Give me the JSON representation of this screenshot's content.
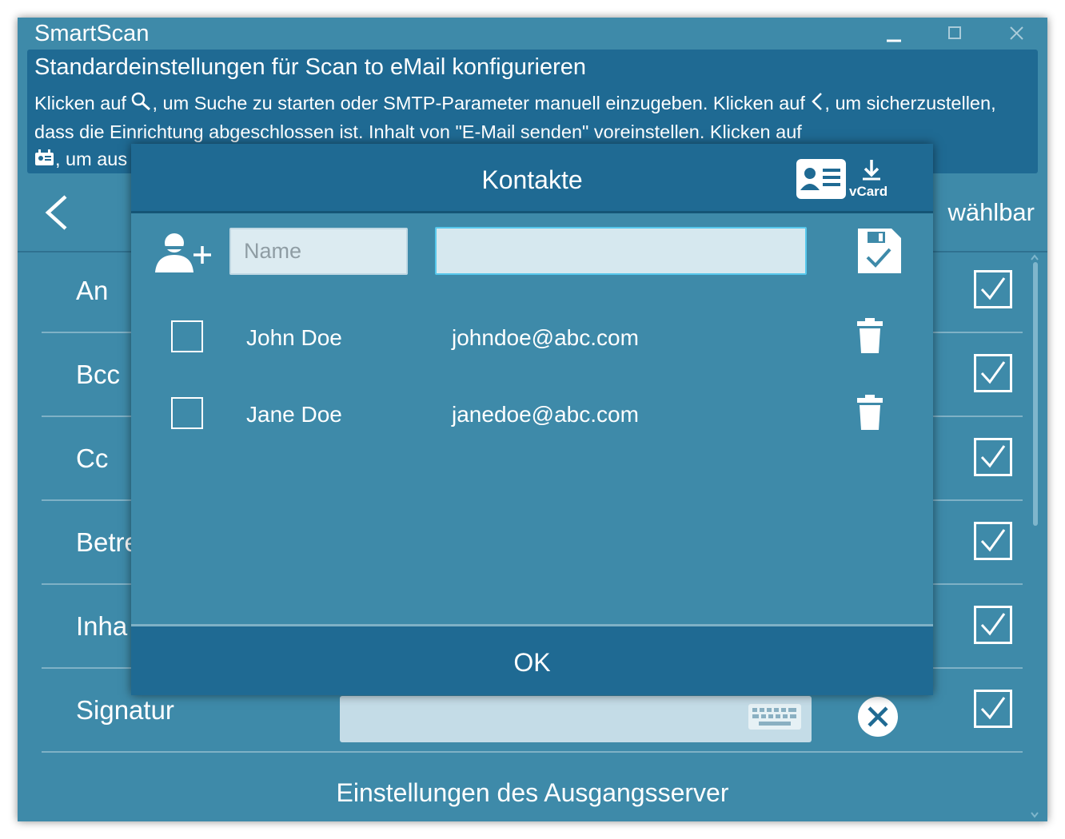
{
  "window": {
    "title": "SmartScan",
    "controls": [
      "minimize-icon",
      "maximize-icon",
      "close-icon"
    ]
  },
  "header": {
    "title": "Standardeinstellungen für Scan to eMail konfigurieren",
    "desc_part1": "Klicken auf ",
    "desc_part2": ", um Suche zu starten oder SMTP-Parameter manuell einzugeben. Klicken auf ",
    "desc_part3": ", um sicherzustellen, dass die Einrichtung abgeschlossen ist. Inhalt von \"E-Mail senden\" voreinstellen. Klicken auf ",
    "desc_part4": ", um aus",
    "icons": [
      "search-icon",
      "chevron-left-icon",
      "contacts-card-icon"
    ]
  },
  "settings": {
    "column_header": "wählbar",
    "rows": [
      {
        "label": "An",
        "checked": true
      },
      {
        "label": "Bcc",
        "checked": true
      },
      {
        "label": "Cc",
        "checked": true
      },
      {
        "label": "Betre",
        "checked": true
      },
      {
        "label": "Inha",
        "checked": true
      },
      {
        "label": "Signatur",
        "checked": true
      }
    ],
    "footer_label": "Einstellungen des Ausgangsserver"
  },
  "dialog": {
    "title": "Kontakte",
    "vcard_label": "vCard",
    "name_placeholder": "Name",
    "email_value": "",
    "contacts": [
      {
        "name": "John Doe",
        "email": "johndoe@abc.com",
        "selected": false
      },
      {
        "name": "Jane Doe",
        "email": "janedoe@abc.com",
        "selected": false
      }
    ],
    "ok_label": "OK"
  },
  "colors": {
    "background": "#3e8aa9",
    "header_band": "#1f6a93",
    "input_bg": "#d6e8ef",
    "input_focus_border": "#57c8ec"
  }
}
